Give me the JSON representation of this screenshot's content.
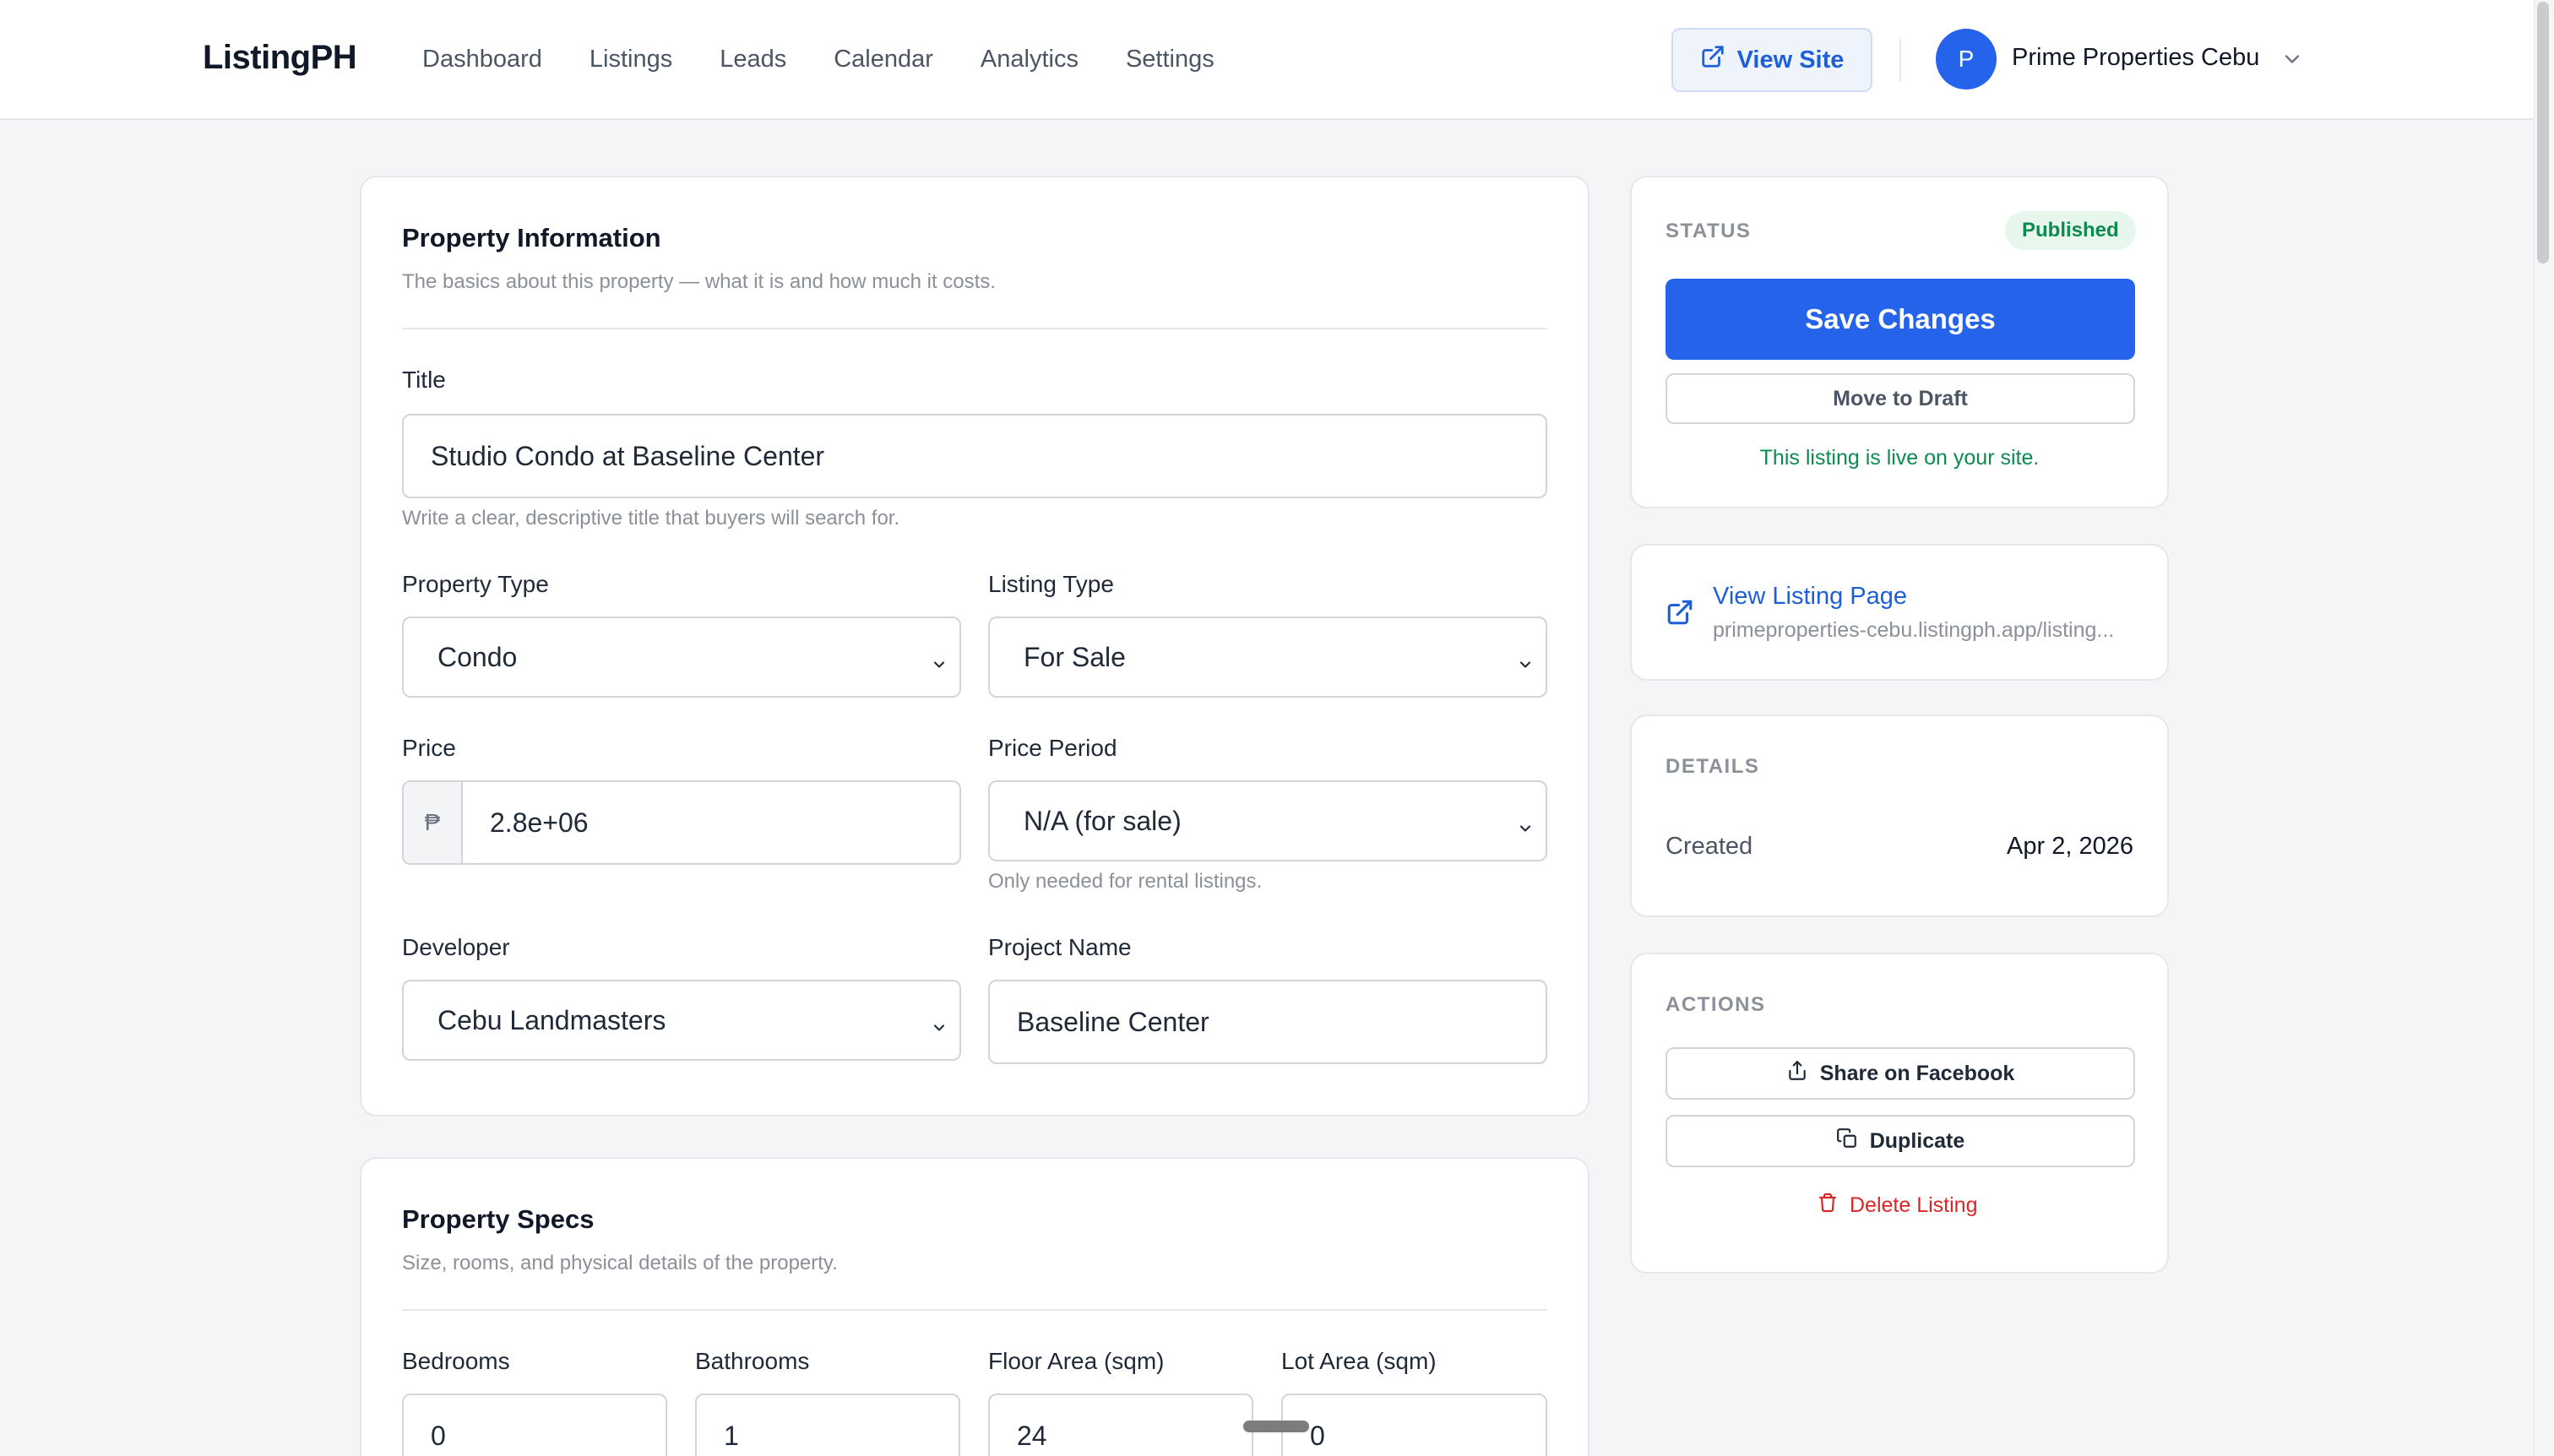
{
  "header": {
    "brand": "ListingPH",
    "nav": [
      "Dashboard",
      "Listings",
      "Leads",
      "Calendar",
      "Analytics",
      "Settings"
    ],
    "view_site_label": "View Site",
    "avatar_initial": "P",
    "org_name": "Prime Properties Cebu"
  },
  "property_info": {
    "title": "Property Information",
    "subtitle": "The basics about this property — what it is and how much it costs.",
    "title_field": {
      "label": "Title",
      "value": "Studio Condo at Baseline Center",
      "hint": "Write a clear, descriptive title that buyers will search for."
    },
    "property_type": {
      "label": "Property Type",
      "value": "Condo"
    },
    "listing_type": {
      "label": "Listing Type",
      "value": "For Sale"
    },
    "price": {
      "label": "Price",
      "currency": "₱",
      "value": "2.8e+06"
    },
    "price_period": {
      "label": "Price Period",
      "value": "N/A (for sale)",
      "hint": "Only needed for rental listings."
    },
    "developer": {
      "label": "Developer",
      "value": "Cebu Landmasters"
    },
    "project_name": {
      "label": "Project Name",
      "value": "Baseline Center"
    }
  },
  "property_specs": {
    "title": "Property Specs",
    "subtitle": "Size, rooms, and physical details of the property.",
    "bedrooms": {
      "label": "Bedrooms",
      "value": "0"
    },
    "bathrooms": {
      "label": "Bathrooms",
      "value": "1"
    },
    "floor_area": {
      "label": "Floor Area (sqm)",
      "value": "24"
    },
    "lot_area": {
      "label": "Lot Area (sqm)",
      "value": "0"
    }
  },
  "status_card": {
    "caption": "STATUS",
    "badge": "Published",
    "save_label": "Save Changes",
    "draft_label": "Move to Draft",
    "note": "This listing is live on your site."
  },
  "link_card": {
    "title": "View Listing Page",
    "url": "primeproperties-cebu.listingph.app/listing..."
  },
  "details_card": {
    "caption": "DETAILS",
    "created_label": "Created",
    "created_value": "Apr 2, 2026"
  },
  "actions_card": {
    "caption": "ACTIONS",
    "share_label": "Share on Facebook",
    "duplicate_label": "Duplicate",
    "delete_label": "Delete Listing"
  },
  "colors": {
    "accent": "#2563eb",
    "published_green": "#0d8a4f",
    "danger": "#dc2626"
  }
}
